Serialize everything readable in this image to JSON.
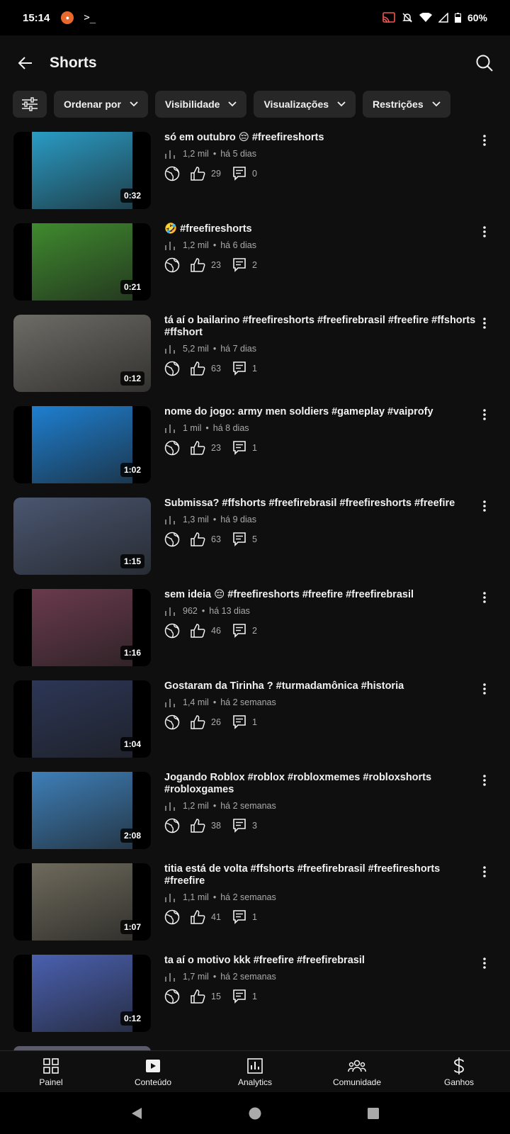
{
  "status_bar": {
    "time": "15:14",
    "battery": "60%"
  },
  "header": {
    "title": "Shorts"
  },
  "filters": [
    {
      "label": "Ordenar por"
    },
    {
      "label": "Visibilidade"
    },
    {
      "label": "Visualizações"
    },
    {
      "label": "Restrições"
    }
  ],
  "videos": [
    {
      "title": "só em outubro 😔 #freefireshorts",
      "views": "1,2 mil",
      "age": "há 5 dias",
      "likes": "29",
      "comments": "0",
      "duration": "0:32"
    },
    {
      "title": "🤣 #freefireshorts",
      "views": "1,2 mil",
      "age": "há 6 dias",
      "likes": "23",
      "comments": "2",
      "duration": "0:21"
    },
    {
      "title": "tá aí o bailarino #freefireshorts #freefirebrasil #freefire #ffshorts #ffshort",
      "views": "5,2 mil",
      "age": "há 7 dias",
      "likes": "63",
      "comments": "1",
      "duration": "0:12"
    },
    {
      "title": "nome do jogo: army men soldiers #gameplay #vaiprofy",
      "views": "1 mil",
      "age": "há 8 dias",
      "likes": "23",
      "comments": "1",
      "duration": "1:02"
    },
    {
      "title": "Submissa? #ffshorts #freefirebrasil #freefireshorts #freefire",
      "views": "1,3 mil",
      "age": "há 9 dias",
      "likes": "63",
      "comments": "5",
      "duration": "1:15"
    },
    {
      "title": "sem ideia 😔 #freefireshorts #freefire #freefirebrasil",
      "views": "962",
      "age": "há 13 dias",
      "likes": "46",
      "comments": "2",
      "duration": "1:16"
    },
    {
      "title": "Gostaram da Tirinha ? #turmadamônica #historia",
      "views": "1,4 mil",
      "age": "há 2 semanas",
      "likes": "26",
      "comments": "1",
      "duration": "1:04"
    },
    {
      "title": "Jogando Roblox #roblox #robloxmemes #robloxshorts #robloxgames",
      "views": "1,2 mil",
      "age": "há 2 semanas",
      "likes": "38",
      "comments": "3",
      "duration": "2:08"
    },
    {
      "title": "titia está de volta #ffshorts #freefirebrasil #freefireshorts #freefire",
      "views": "1,1 mil",
      "age": "há 2 semanas",
      "likes": "41",
      "comments": "1",
      "duration": "1:07"
    },
    {
      "title": "ta aí o motivo kkk #freefire #freefirebrasil",
      "views": "1,7 mil",
      "age": "há 2 semanas",
      "likes": "15",
      "comments": "1",
      "duration": "0:12"
    }
  ],
  "bottom_nav": [
    {
      "label": "Painel",
      "icon": "dashboard-icon"
    },
    {
      "label": "Conteúdo",
      "icon": "content-icon"
    },
    {
      "label": "Analytics",
      "icon": "analytics-icon"
    },
    {
      "label": "Comunidade",
      "icon": "community-icon"
    },
    {
      "label": "Ganhos",
      "icon": "earnings-icon"
    }
  ],
  "thumb_colors": [
    "#2a9bc4",
    "#3f8a2e",
    "#6e6c66",
    "#1e7fd0",
    "#4a5670",
    "#6a3a4c",
    "#2c3656",
    "#3e7fb8",
    "#6e6a5c",
    "#4a60b0"
  ],
  "colors": {
    "background": "#0f0f0f",
    "chip": "#272727",
    "text": "#f1f1f1",
    "secondary": "#aaaaaa"
  }
}
